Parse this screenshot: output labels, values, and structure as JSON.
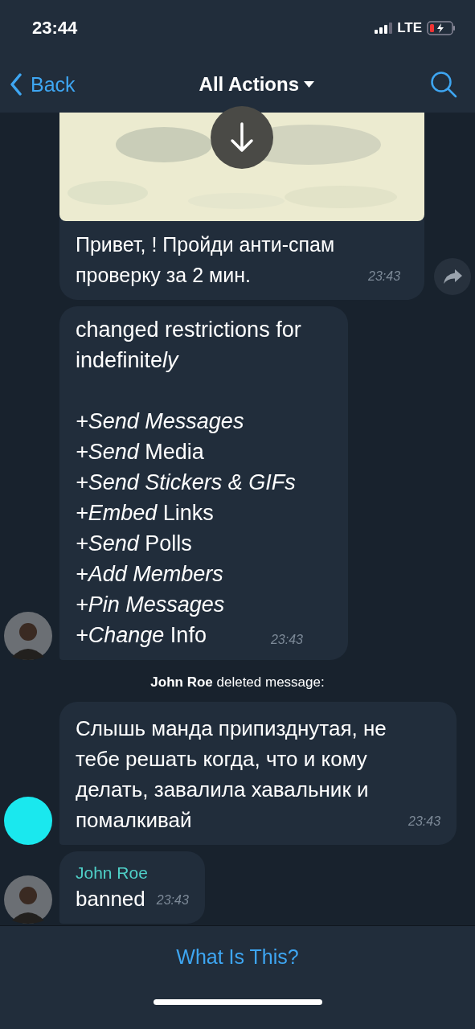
{
  "status_bar": {
    "time": "23:44",
    "network": "LTE"
  },
  "nav": {
    "back": "Back",
    "title": "All Actions"
  },
  "messages": [
    {
      "kind": "media",
      "text": "Привет, ! Пройди анти-спам проверку за 2 мин.",
      "time": "23:43"
    },
    {
      "kind": "list",
      "text": "changed restrictions for indefinite",
      "text_italic_end": "ly",
      "items": [
        "*+Send Messages*",
        "*+Send* Media",
        "*+Send Stickers & GIFs*",
        "*+Embed* Links",
        "*+Send* Polls",
        "*+Add Members*",
        "*+Pin Messages*",
        "*+Change* Info"
      ],
      "time": "23:43"
    },
    {
      "kind": "service",
      "text": "**John Roe** deleted message:"
    },
    {
      "kind": "text",
      "text": "Слышь манда припизднутая, не тебе решать когда, что и кому делать, завалила хавальник и помалкивай",
      "time": "23:43",
      "avatar": {
        "kind": "color",
        "color": "#1ae8ee"
      }
    },
    {
      "kind": "text",
      "sender": "John Roe",
      "text": "banned",
      "time": "23:43"
    }
  ],
  "footer": {
    "link": "What Is This?"
  }
}
